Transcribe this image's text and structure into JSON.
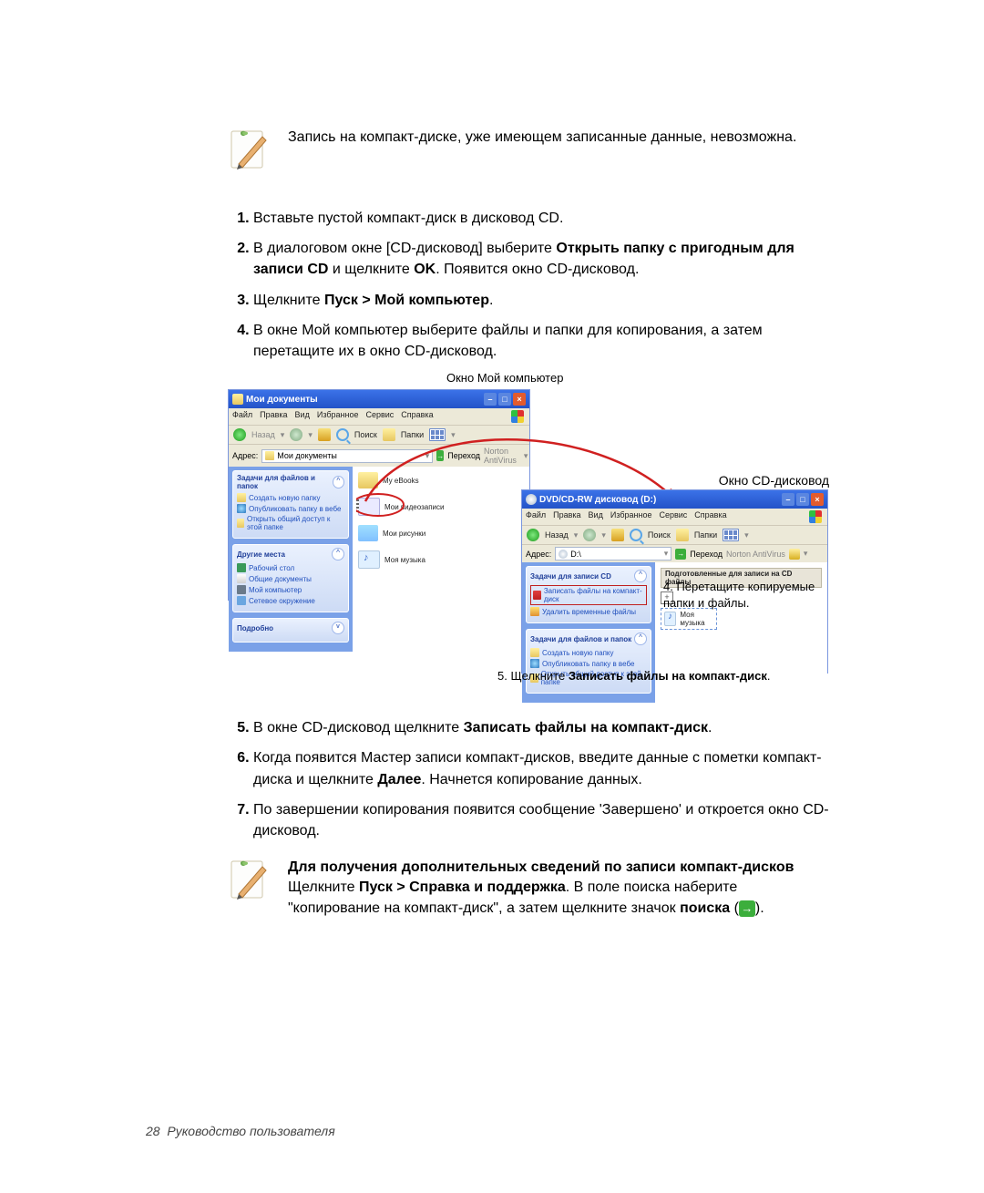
{
  "note1": {
    "text": "Запись на компакт-диске, уже имеющем записанные данные, невозможна."
  },
  "steps": {
    "s1": "Вставьте пустой компакт-диск в дисковод CD.",
    "s2_a": "В диалоговом окне [CD-дисковод] выберите ",
    "s2_b": "Открыть папку с пригодным для записи CD",
    "s2_c": " и щелкните ",
    "s2_d": "OK",
    "s2_e": ". Появится окно CD-дисковод.",
    "s3_a": "Щелкните ",
    "s3_b": "Пуск > Мой компьютер",
    "s3_c": ".",
    "s4": "В окне Мой компьютер выберите файлы и папки для копирования, а затем перетащите их в окно CD-дисковод.",
    "s5_a": "В окне CD-дисковод щелкните ",
    "s5_b": "Записать файлы на компакт-диск",
    "s5_c": ".",
    "s6_a": "Когда появится Мастер записи компакт-дисков, введите данные с пометки компакт-диска и щелкните ",
    "s6_b": "Далее",
    "s6_c": ". Начнется копирование данных.",
    "s7": "По завершении копирования появится сообщение 'Завершено' и откроется окно CD-дисковод."
  },
  "fig": {
    "caption_top": "Окно Мой компьютер",
    "caption_cd": "Окно CD-дисковод",
    "win1_title": "Мои документы",
    "win2_title": "DVD/CD-RW дисковод (D:)",
    "menu": {
      "file": "Файл",
      "edit": "Правка",
      "view": "Вид",
      "fav": "Избранное",
      "tools": "Сервис",
      "help": "Справка"
    },
    "tb": {
      "back": "Назад",
      "search": "Поиск",
      "folders": "Папки"
    },
    "addr_label": "Адрес:",
    "addr1": "Мои документы",
    "addr2": "D:\\",
    "go": "Переход",
    "av": "Norton AntiVirus",
    "panels": {
      "tasks_head": "Задачи для файлов и папок",
      "tasks": {
        "t1": "Создать новую папку",
        "t2": "Опубликовать папку в вебе",
        "t3": "Открыть общий доступ к этой папке"
      },
      "cd_head": "Задачи для записи CD",
      "cd_tasks": {
        "c1": "Записать файлы на компакт-диск",
        "c2": "Удалить временные файлы"
      },
      "tasks_head2": "Задачи для файлов и папок",
      "ft": {
        "f1": "Создать новую папку",
        "f2": "Опубликовать папку в вебе",
        "f3": "Открыть общий доступ к этой папке"
      },
      "places_head": "Другие места",
      "places": {
        "p1": "Рабочий стол",
        "p2": "Общие документы",
        "p3": "Мой компьютер",
        "p4": "Сетевое окружение"
      },
      "details_head": "Подробно"
    },
    "folders": {
      "f1": "My eBooks",
      "f2": "Мои видеозаписи",
      "f3": "Мои рисунки",
      "f4": "Моя музыка"
    },
    "prepared": "Подготовленные для записи на CD файлы",
    "music": "Моя музыка"
  },
  "callouts": {
    "c4": "4. Перетащите копируемые папки и файлы.",
    "c5_a": "5. Щелкните ",
    "c5_b": "Записать файлы на компакт-диск",
    "c5_c": "."
  },
  "note2": {
    "head": "Для получения дополнительных сведений по записи компакт-дисков",
    "a": "Щелкните ",
    "b": "Пуск > Справка и поддержка",
    "c": ". В поле поиска наберите \"копирование на компакт-диск\", а затем щелкните значок ",
    "d": "поиска",
    "e": " (",
    "f": ")."
  },
  "footer": {
    "page": "28",
    "label": "Руководство пользователя"
  }
}
